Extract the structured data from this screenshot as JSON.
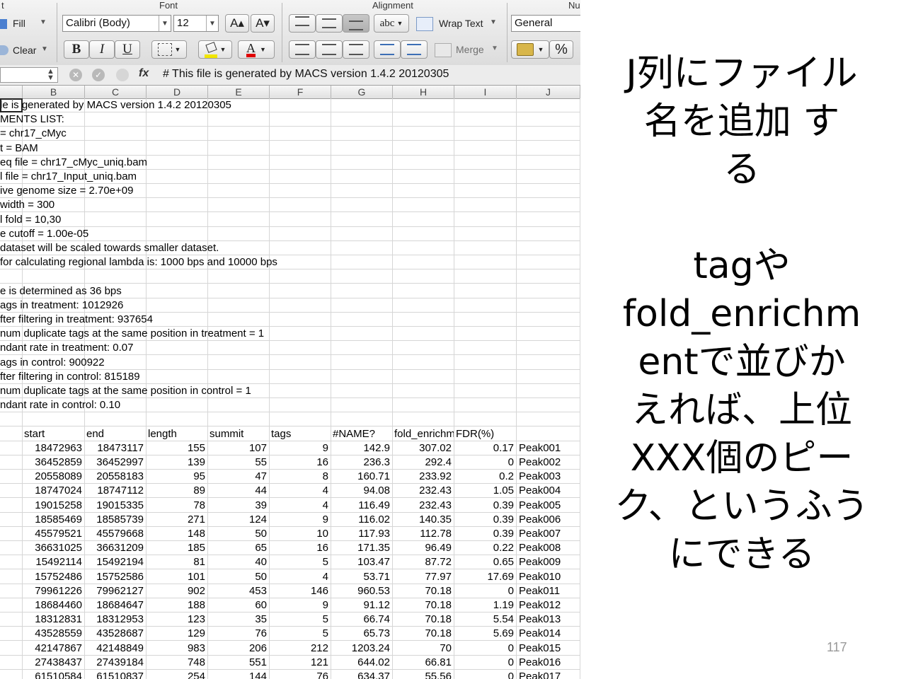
{
  "ribbon": {
    "groups": {
      "font": "Font",
      "alignment": "Alignment",
      "number": "Nu"
    },
    "clipped_label": "t",
    "fill_label": "Fill",
    "clear_label": "Clear",
    "font_name": "Calibri (Body)",
    "font_size": "12",
    "grow_font": "A▴",
    "shrink_font": "A▾",
    "bold": "B",
    "italic": "I",
    "underline": "U",
    "abc": "abc",
    "wrap_text": "Wrap Text",
    "merge": "Merge",
    "number_format": "General",
    "percent": "%"
  },
  "formula_bar": {
    "fx": "fx",
    "content": "# This file is generated by MACS version 1.4.2 20120305"
  },
  "columns": [
    "B",
    "C",
    "D",
    "E",
    "F",
    "G",
    "H",
    "I",
    "J"
  ],
  "text_rows": [
    "le is generated by MACS version 1.4.2 20120305",
    "MENTS LIST:",
    "= chr17_cMyc",
    "t = BAM",
    "eq file = chr17_cMyc_uniq.bam",
    "l file = chr17_Input_uniq.bam",
    "ive genome size = 2.70e+09",
    "width = 300",
    "l fold = 10,30",
    "e cutoff = 1.00e-05",
    "dataset will be scaled towards smaller dataset.",
    " for calculating regional lambda is: 1000 bps and 10000 bps",
    "",
    "e is determined as 36 bps",
    "ags in treatment: 1012926",
    "fter filtering in treatment: 937654",
    "num duplicate tags at the same position in treatment = 1",
    "ndant rate in treatment: 0.07",
    "ags in control: 900922",
    "fter filtering in control: 815189",
    "num duplicate tags at the same position in control = 1",
    "ndant rate in control: 0.10",
    ""
  ],
  "table_header": [
    "start",
    "end",
    "length",
    "summit",
    "tags",
    "#NAME?",
    "fold_enrichm",
    "FDR(%)",
    ""
  ],
  "table_rows": [
    [
      "18472963",
      "18473117",
      "155",
      "107",
      "9",
      "142.9",
      "307.02",
      "0.17",
      "Peak001"
    ],
    [
      "36452859",
      "36452997",
      "139",
      "55",
      "16",
      "236.3",
      "292.4",
      "0",
      "Peak002"
    ],
    [
      "20558089",
      "20558183",
      "95",
      "47",
      "8",
      "160.71",
      "233.92",
      "0.2",
      "Peak003"
    ],
    [
      "18747024",
      "18747112",
      "89",
      "44",
      "4",
      "94.08",
      "232.43",
      "1.05",
      "Peak004"
    ],
    [
      "19015258",
      "19015335",
      "78",
      "39",
      "4",
      "116.49",
      "232.43",
      "0.39",
      "Peak005"
    ],
    [
      "18585469",
      "18585739",
      "271",
      "124",
      "9",
      "116.02",
      "140.35",
      "0.39",
      "Peak006"
    ],
    [
      "45579521",
      "45579668",
      "148",
      "50",
      "10",
      "117.93",
      "112.78",
      "0.39",
      "Peak007"
    ],
    [
      "36631025",
      "36631209",
      "185",
      "65",
      "16",
      "171.35",
      "96.49",
      "0.22",
      "Peak008"
    ],
    [
      "15492114",
      "15492194",
      "81",
      "40",
      "5",
      "103.47",
      "87.72",
      "0.65",
      "Peak009"
    ],
    [
      "15752486",
      "15752586",
      "101",
      "50",
      "4",
      "53.71",
      "77.97",
      "17.69",
      "Peak010"
    ],
    [
      "79961226",
      "79962127",
      "902",
      "453",
      "146",
      "960.53",
      "70.18",
      "0",
      "Peak011"
    ],
    [
      "18684460",
      "18684647",
      "188",
      "60",
      "9",
      "91.12",
      "70.18",
      "1.19",
      "Peak012"
    ],
    [
      "18312831",
      "18312953",
      "123",
      "35",
      "5",
      "66.74",
      "70.18",
      "5.54",
      "Peak013"
    ],
    [
      "43528559",
      "43528687",
      "129",
      "76",
      "5",
      "65.73",
      "70.18",
      "5.69",
      "Peak014"
    ],
    [
      "42147867",
      "42148849",
      "983",
      "206",
      "212",
      "1203.24",
      "70",
      "0",
      "Peak015"
    ],
    [
      "27438437",
      "27439184",
      "748",
      "551",
      "121",
      "644.02",
      "66.81",
      "0",
      "Peak016"
    ],
    [
      "61510584",
      "61510837",
      "254",
      "144",
      "76",
      "634.37",
      "55.56",
      "0",
      "Peak017"
    ]
  ],
  "slide": {
    "para1": [
      "J列にファイル",
      "名を追加 す",
      "る"
    ],
    "para2": [
      "tagや",
      "fold_enrichm",
      "entで並びか",
      "えれば、上位",
      "XXX個のピー",
      "ク、というふう",
      "にできる"
    ],
    "page_number": "117"
  }
}
